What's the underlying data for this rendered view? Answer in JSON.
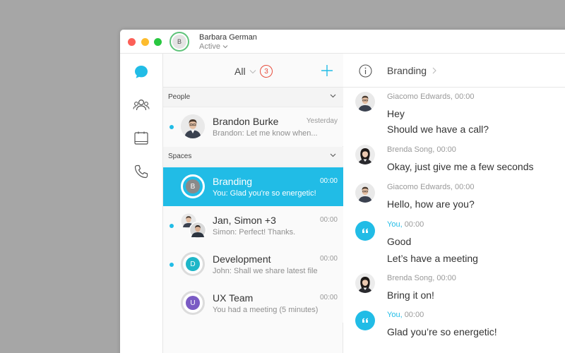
{
  "user": {
    "name": "Barbara German",
    "status": "Active",
    "initial": "B"
  },
  "list": {
    "filter_label": "All",
    "badge_count": "3",
    "sections": {
      "people": "People",
      "spaces": "Spaces"
    },
    "people": [
      {
        "name": "Brandon Burke",
        "time": "Yesterday",
        "preview": "Brandon: Let me know when...",
        "unread": true
      }
    ],
    "spaces": [
      {
        "name": "Branding",
        "time": "00:00",
        "preview": "You: Glad you're so energetic!",
        "initial": "B",
        "selected": true
      },
      {
        "name": "Jan, Simon +3",
        "time": "00:00",
        "preview": "Simon: Perfect! Thanks.",
        "unread": true
      },
      {
        "name": "Development",
        "time": "00:00",
        "preview": "John: Shall we share latest file",
        "initial": "D",
        "color": "#1fb6c8",
        "unread": true
      },
      {
        "name": "UX Team",
        "time": "00:00",
        "preview": "You had a meeting (5 minutes)",
        "initial": "U",
        "color": "#7a5bc4"
      }
    ]
  },
  "chat": {
    "title": "Branding",
    "messages": [
      {
        "sender": "Giacomo Edwards",
        "time": "00:00",
        "lines": [
          "Hey",
          "Should we have a call?"
        ]
      },
      {
        "sender": "Brenda Song",
        "time": "00:00",
        "lines": [
          "Okay, just give me a few seconds"
        ]
      },
      {
        "sender": "Giacomo Edwards",
        "time": "00:00",
        "lines": [
          "Hello, how are you?"
        ]
      },
      {
        "sender": "You,",
        "time": "00:00",
        "lines": [
          "Good",
          "Let’s have a meeting"
        ]
      },
      {
        "sender": "Brenda Song",
        "time": "00:00",
        "lines": [
          "Bring it on!"
        ]
      },
      {
        "sender": "You,",
        "time": "00:00",
        "lines": [
          "Glad you’re so energetic!"
        ]
      }
    ]
  },
  "icons": {
    "rail": [
      "messages-icon",
      "teams-icon",
      "calendar-icon",
      "calls-icon"
    ],
    "accent": "#21bce6"
  }
}
